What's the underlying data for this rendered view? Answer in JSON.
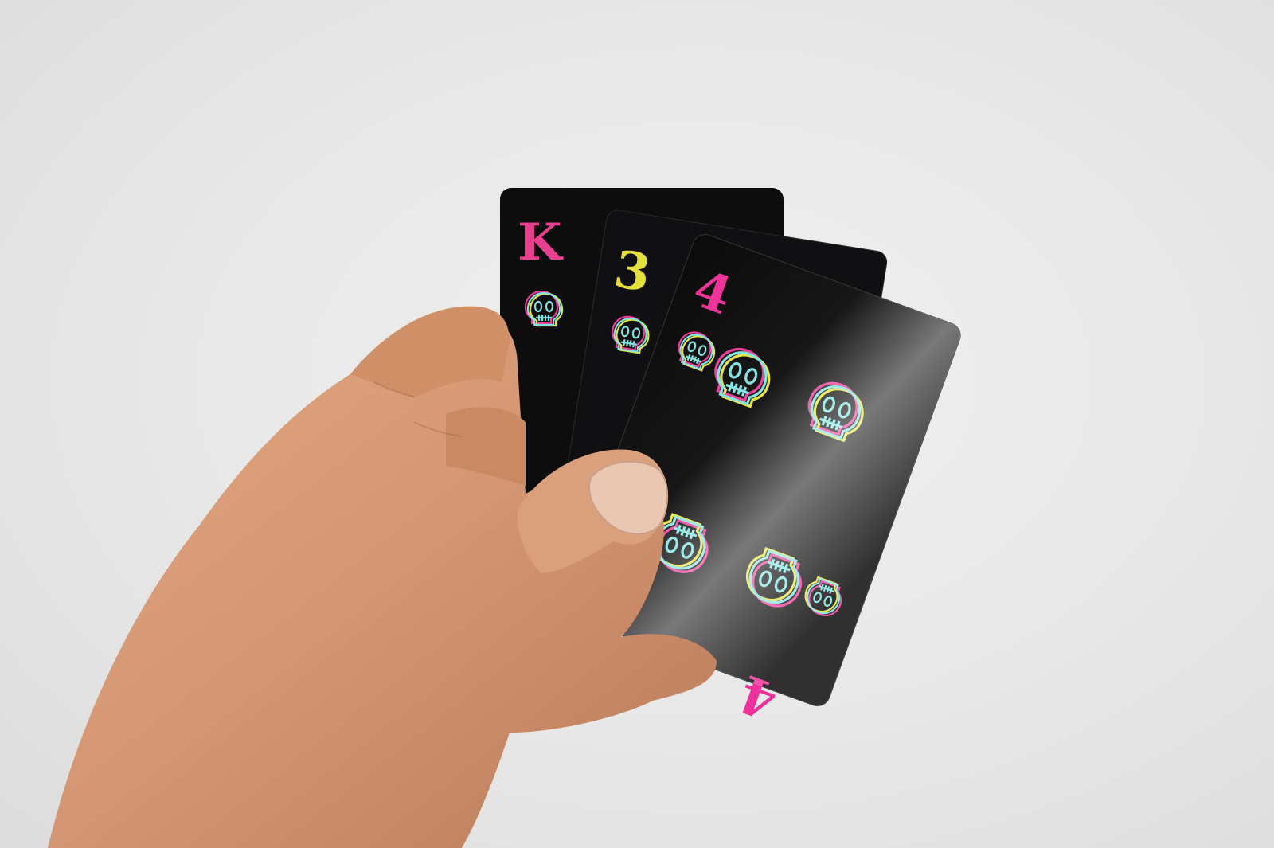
{
  "scene": {
    "background_color": "#e9e9e9",
    "card_color": "#0d0d0e",
    "skin_color": "#d49672"
  },
  "cards": [
    {
      "id": "back",
      "rank": "K",
      "rank_color": "#e8408f",
      "pip_icon": "skull-icon"
    },
    {
      "id": "middle",
      "rank": "3",
      "rank_color": "#e6e03a",
      "pip_icon": "skull-icon"
    },
    {
      "id": "front",
      "rank": "4",
      "rank_color": "#f0309a",
      "pip_icon": "skull-icon"
    }
  ],
  "neon_colors": {
    "pink": "#f0389a",
    "yellow": "#e8e43c",
    "cyan": "#7fe3e0"
  }
}
